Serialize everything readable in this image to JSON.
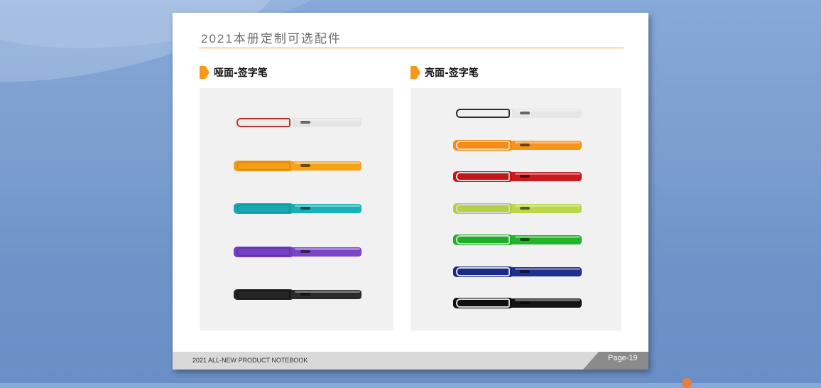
{
  "page": {
    "title": "2021本册定制可选配件",
    "footer_text": "2021 ALL-NEW PRODUCT NOTEBOOK",
    "page_number": "Page-19"
  },
  "sections": [
    {
      "label": "哑面-签字笔",
      "pens": [
        {
          "color": "white",
          "body": "#e4e4e4",
          "cap": "#ececec",
          "clip": "#c0332b"
        },
        {
          "color": "orange",
          "body": "#f4a418",
          "cap": "#f2a016",
          "clip": "#e08a10"
        },
        {
          "color": "teal",
          "body": "#18b1b7",
          "cap": "#16abb2",
          "clip": "#109a9f"
        },
        {
          "color": "purple",
          "body": "#7a44c7",
          "cap": "#7441c4",
          "clip": "#6334b0"
        },
        {
          "color": "black",
          "body": "#2a2a2a",
          "cap": "#262626",
          "clip": "#161616"
        }
      ]
    },
    {
      "label": "亮面-签字笔",
      "pens": [
        {
          "color": "white",
          "body": "#e6e6e6",
          "cap": "#f0f0f0",
          "clip": "#2b2b2b"
        },
        {
          "color": "orange",
          "body": "#f7941a",
          "cap": "#f58d14",
          "clip": "#d8d8d8"
        },
        {
          "color": "red",
          "body": "#c81a1f",
          "cap": "#c3161b",
          "clip": "#d8d8d8"
        },
        {
          "color": "lime",
          "body": "#b9d84a",
          "cap": "#b2d140",
          "clip": "#d8d8d8"
        },
        {
          "color": "green",
          "body": "#22b52a",
          "cap": "#1eaf26",
          "clip": "#d8d8d8"
        },
        {
          "color": "navy",
          "body": "#1f2f8e",
          "cap": "#1b2a88",
          "clip": "#d8d8d8"
        },
        {
          "color": "black",
          "body": "#141414",
          "cap": "#111111",
          "clip": "#d8d8d8"
        }
      ]
    }
  ],
  "colors": {
    "accent": "#f59a18",
    "footer_bar": "#d9d9d9",
    "page_tab": "#8a8a8a"
  }
}
